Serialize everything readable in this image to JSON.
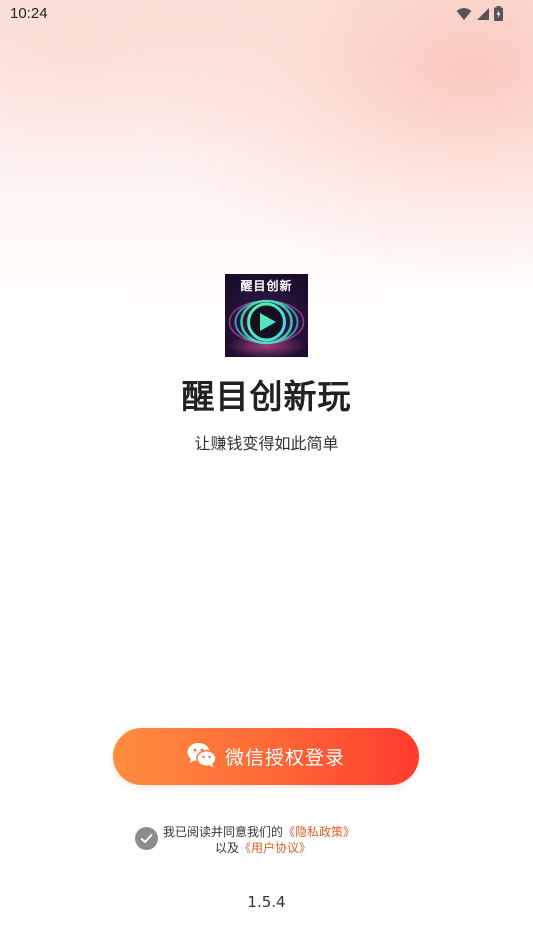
{
  "status_bar": {
    "time": "10:24",
    "icons": [
      "wifi-icon",
      "signal-icon",
      "battery-icon"
    ]
  },
  "logo": {
    "text": "醒目创新",
    "icon": "play-icon",
    "colors": {
      "ring_green": "#5cf0a0",
      "ring_cyan": "#40d8f0",
      "background": "#221035"
    }
  },
  "app": {
    "name": "醒目创新玩",
    "slogan": "让赚钱变得如此简单"
  },
  "login_button": {
    "icon": "wechat-icon",
    "label": "微信授权登录",
    "colors": {
      "start": "#ff8d3f",
      "end": "#ff3b2f"
    }
  },
  "agreement": {
    "checked": true,
    "prefix": "我已阅读并同意我们的",
    "privacy_link": "《隐私政策》",
    "joiner": "以及",
    "terms_link": "《用户协议》",
    "link_color": "#e0602a"
  },
  "version": "1.5.4"
}
